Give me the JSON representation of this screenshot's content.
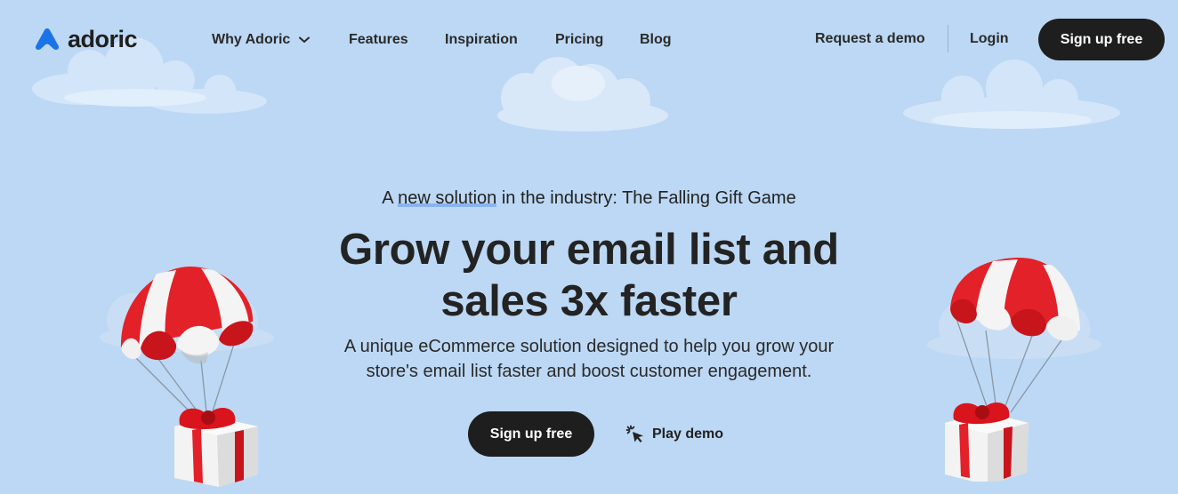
{
  "brand": {
    "name": "adoric",
    "icon": "adoric-triangle-logo",
    "color": "#1a73e8"
  },
  "nav": {
    "items": [
      {
        "label": "Why Adoric",
        "has_dropdown": true
      },
      {
        "label": "Features"
      },
      {
        "label": "Inspiration"
      },
      {
        "label": "Pricing"
      },
      {
        "label": "Blog"
      }
    ],
    "request_demo": "Request a demo",
    "login": "Login",
    "signup": "Sign up free"
  },
  "hero": {
    "eyebrow_pre": "A ",
    "eyebrow_highlight": "new solution",
    "eyebrow_post": " in the industry: The Falling Gift Game",
    "headline_line1": "Grow your email list and",
    "headline_line2": "sales 3x faster",
    "sub_line1": "A unique eCommerce solution designed to help you grow your",
    "sub_line2": "store's email list faster and boost customer engagement.",
    "cta": "Sign up free",
    "play_demo": "Play demo",
    "play_icon": "click-cursor-icon"
  },
  "colors": {
    "background": "#bcd8f4",
    "button_dark": "#1e1e1e",
    "parachute_red": "#e8232a",
    "highlight": "#8ab4ee"
  }
}
